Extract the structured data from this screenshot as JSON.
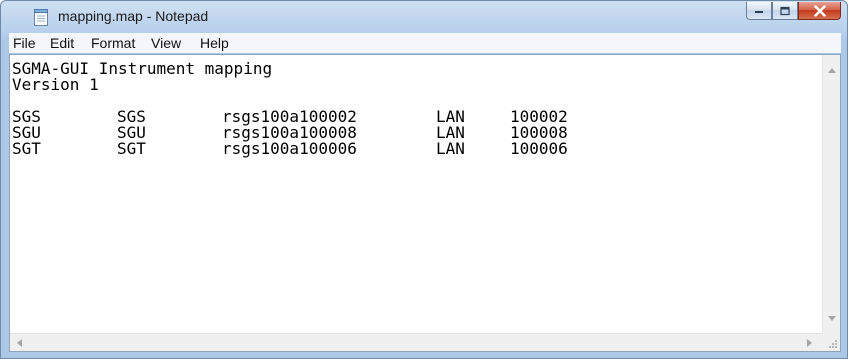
{
  "window": {
    "title": "mapping.map - Notepad"
  },
  "icons": {
    "app": "notepad-icon",
    "minimize": "minimize-icon",
    "maximize": "maximize-icon",
    "close": "close-icon"
  },
  "menu": [
    "File",
    "Edit",
    "Format",
    "View",
    "Help"
  ],
  "document": {
    "header_line_1": "SGMA-GUI Instrument mapping",
    "header_line_2": "Version 1",
    "rows": [
      [
        "SGS",
        "SGS",
        "rsgs100a100002",
        "LAN",
        "100002"
      ],
      [
        "SGU",
        "SGU",
        "rsgs100a100008",
        "LAN",
        "100008"
      ],
      [
        "SGT",
        "SGT",
        "rsgs100a100006",
        "LAN",
        "100006"
      ]
    ]
  }
}
